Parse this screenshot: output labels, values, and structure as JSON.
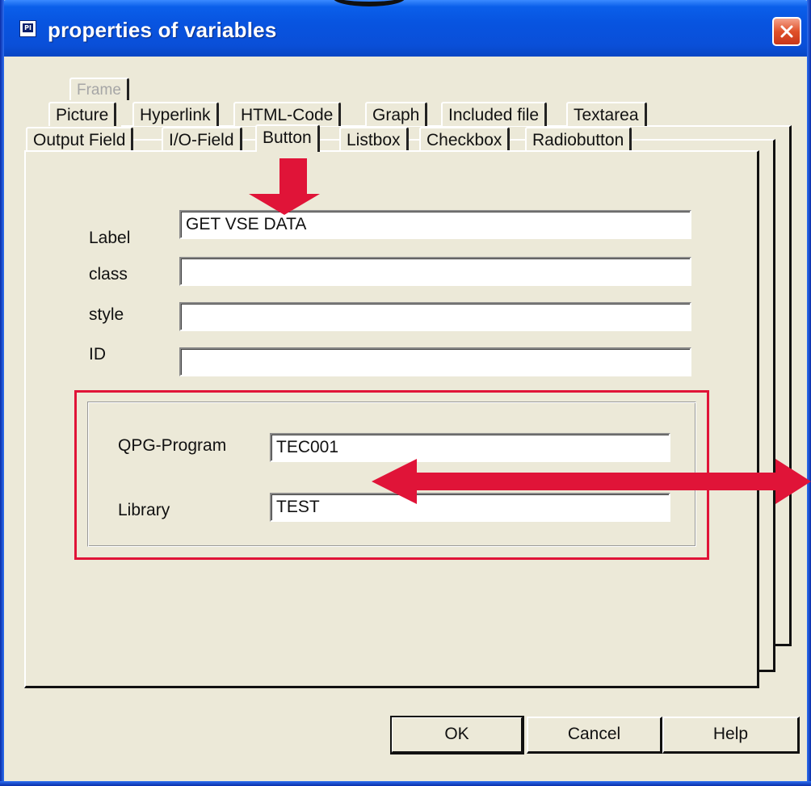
{
  "window": {
    "title": "properties of variables",
    "icon": "pi-app-icon",
    "close_icon": "close-icon"
  },
  "tabs": {
    "row3": [
      "Frame"
    ],
    "row2": [
      "Picture",
      "Hyperlink",
      "HTML-Code",
      "Graph",
      "Included file",
      "Textarea"
    ],
    "row1": [
      "Output Field",
      "I/O-Field",
      "Button",
      "Listbox",
      "Checkbox",
      "Radiobutton"
    ],
    "active": "Button"
  },
  "form": {
    "label_caption": "Label",
    "label_value": "GET VSE DATA",
    "class_caption": "class",
    "class_value": "",
    "style_caption": "style",
    "style_value": "",
    "id_caption": "ID",
    "id_value": "",
    "program_caption": "QPG-Program",
    "program_value": "TEC001",
    "library_caption": "Library",
    "library_value": "TEST"
  },
  "buttons": {
    "ok": "OK",
    "cancel": "Cancel",
    "help": "Help"
  },
  "annotations": {
    "accent_color": "#e01438",
    "highlight_color": "#e01438",
    "arrow_down": "arrow-down-icon",
    "arrow_double": "double-arrow-icon"
  }
}
